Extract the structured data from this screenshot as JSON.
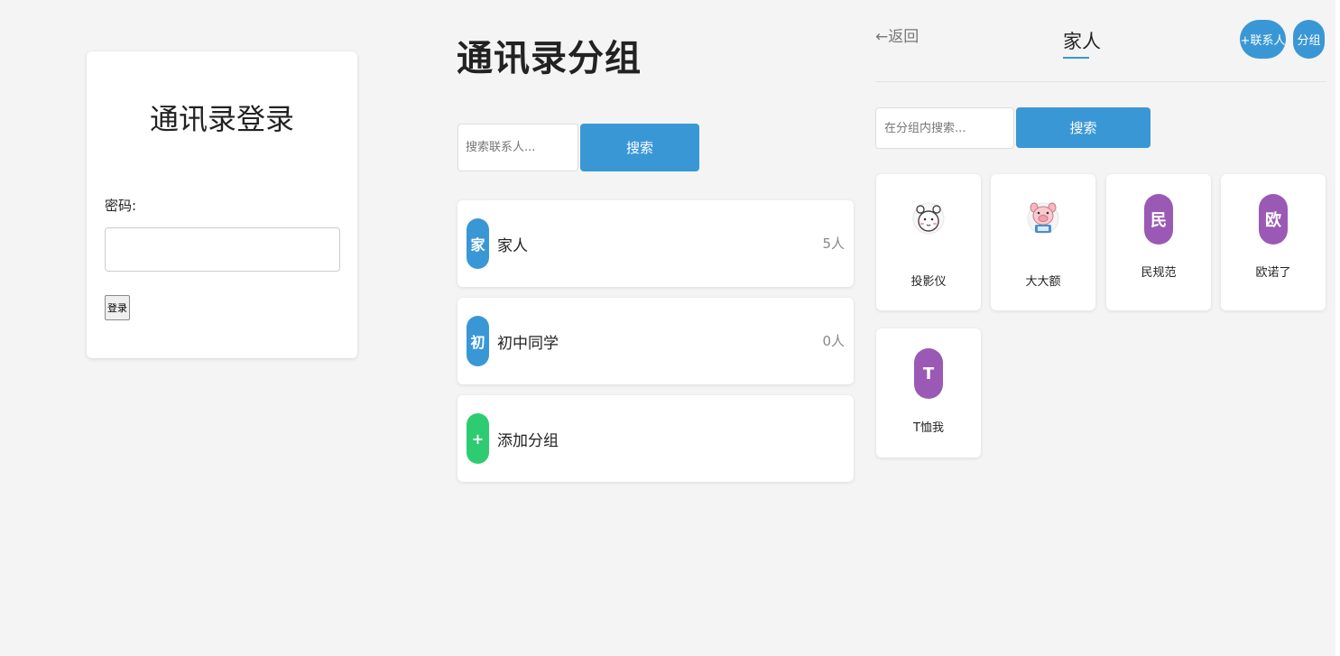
{
  "login": {
    "title": "通讯录登录",
    "password_label": "密码:",
    "password_value": "",
    "submit_label": "登录"
  },
  "groups": {
    "title": "通讯录分组",
    "search_placeholder": "搜索联系人...",
    "search_button": "搜索",
    "items": [
      {
        "avatar": "家",
        "name": "家人",
        "count": "5人",
        "color": "#3a97d6"
      },
      {
        "avatar": "初",
        "name": "初中同学",
        "count": "0人",
        "color": "#3a97d6"
      },
      {
        "avatar": "+",
        "name": "添加分组",
        "count": "",
        "color": "#2ecc71"
      }
    ]
  },
  "detail": {
    "back_label": "←返回",
    "title": "家人",
    "add_contact_label": "+联系人",
    "group_label": "分组",
    "search_placeholder": "在分组内搜索...",
    "search_button": "搜索",
    "contacts": [
      {
        "name": "投影仪",
        "avatar_type": "image",
        "icon": "bear-icon"
      },
      {
        "name": "大大额",
        "avatar_type": "image",
        "icon": "pig-icon"
      },
      {
        "name": "民规范",
        "avatar_type": "letter",
        "letter": "民",
        "color": "#9b59b6"
      },
      {
        "name": "欧诺了",
        "avatar_type": "letter",
        "letter": "欧",
        "color": "#9b59b6"
      },
      {
        "name": "T恤我",
        "avatar_type": "letter",
        "letter": "T",
        "color": "#9b59b6"
      }
    ]
  }
}
